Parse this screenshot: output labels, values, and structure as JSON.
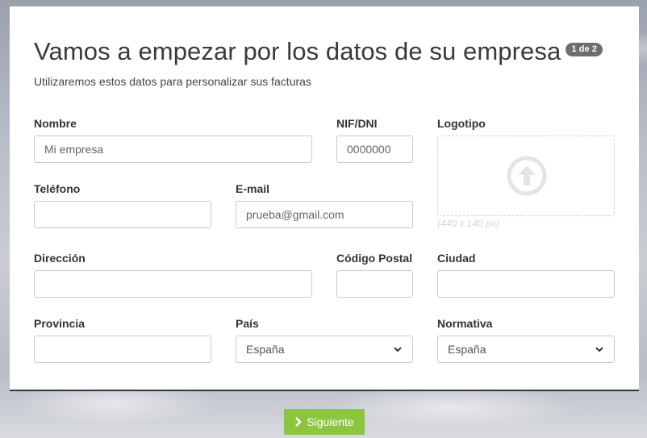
{
  "header": {
    "title": "Vamos a empezar por los datos de su empresa",
    "step_badge": "1 de 2",
    "subtitle": "Utilizaremos estos datos para personalizar sus facturas"
  },
  "form": {
    "nombre": {
      "label": "Nombre",
      "placeholder": "Mi empresa"
    },
    "nif": {
      "label": "NIF/DNI",
      "placeholder": "0000000"
    },
    "logo": {
      "label": "Logotipo",
      "hint": "(440 x 140 px)",
      "icon": "upload-arrow-icon"
    },
    "telefono": {
      "label": "Teléfono",
      "placeholder": ""
    },
    "email": {
      "label": "E-mail",
      "placeholder": "prueba@gmail.com"
    },
    "direccion": {
      "label": "Dirección",
      "placeholder": ""
    },
    "codigo_postal": {
      "label": "Código Postal",
      "placeholder": ""
    },
    "ciudad": {
      "label": "Ciudad",
      "placeholder": ""
    },
    "provincia": {
      "label": "Provincia",
      "placeholder": ""
    },
    "pais": {
      "label": "País",
      "value": "España"
    },
    "normativa": {
      "label": "Normativa",
      "value": "España"
    }
  },
  "actions": {
    "next_label": "Siguiente",
    "next_color": "#8cc63f"
  }
}
